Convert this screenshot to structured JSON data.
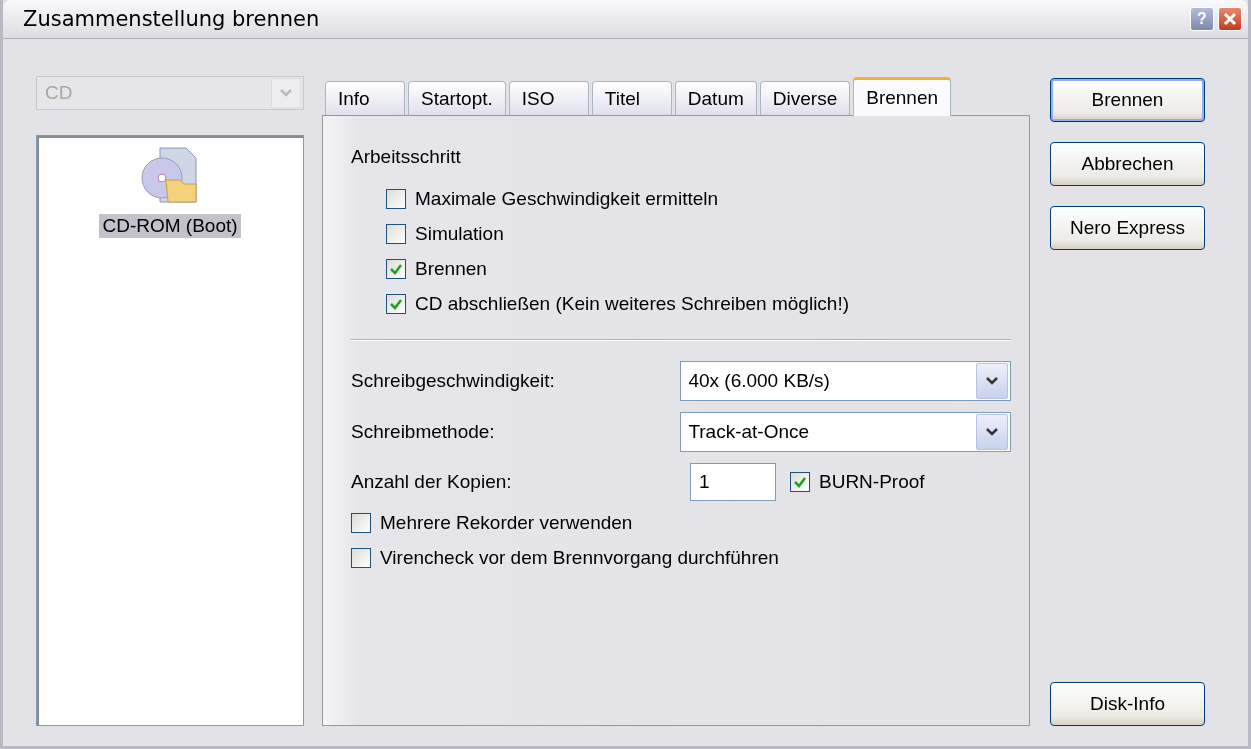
{
  "window": {
    "title": "Zusammenstellung brennen",
    "help_button": "?"
  },
  "disc_type": {
    "value": "CD",
    "disabled": true
  },
  "compilation_list": {
    "items": [
      {
        "label": "CD-ROM (Boot)",
        "selected": true
      }
    ]
  },
  "tabs": [
    {
      "label": "Info",
      "selected": false
    },
    {
      "label": "Startopt.",
      "selected": false
    },
    {
      "label": "ISO",
      "selected": false
    },
    {
      "label": "Titel",
      "selected": false
    },
    {
      "label": "Datum",
      "selected": false
    },
    {
      "label": "Diverse",
      "selected": false
    },
    {
      "label": "Brennen",
      "selected": true
    }
  ],
  "section_title": "Arbeitsschritt",
  "steps": [
    {
      "label": "Maximale Geschwindigkeit ermitteln",
      "checked": false
    },
    {
      "label": "Simulation",
      "checked": false
    },
    {
      "label": "Brennen",
      "checked": true
    },
    {
      "label": "CD abschließen (Kein weiteres Schreiben möglich!)",
      "checked": true
    }
  ],
  "write_speed": {
    "label": "Schreibgeschwindigkeit:",
    "value": "40x (6.000 KB/s)"
  },
  "write_method": {
    "label": "Schreibmethode:",
    "value": "Track-at-Once"
  },
  "copies": {
    "label": "Anzahl der Kopien:",
    "value": "1"
  },
  "burn_proof": {
    "label": "BURN-Proof",
    "checked": true
  },
  "options": [
    {
      "label": "Mehrere Rekorder verwenden",
      "checked": false
    },
    {
      "label": "Virencheck vor dem Brennvorgang durchführen",
      "checked": false
    }
  ],
  "buttons": [
    "Brennen",
    "Abbrechen",
    "Nero Express"
  ],
  "bottom_button": "Disk-Info"
}
